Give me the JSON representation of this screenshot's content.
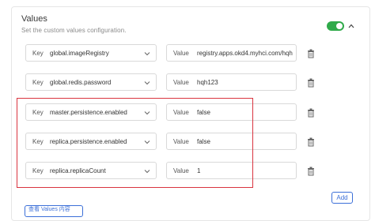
{
  "values_section": {
    "title": "Values",
    "subtitle": "Set the custom values configuration.",
    "toggle_on": true,
    "accent_color": "#2faa4a"
  },
  "rows": [
    {
      "key_label": "Key",
      "key": "global.imageRegistry",
      "value_label": "Value",
      "value": "registry.apps.okd4.myhci.com/hqh"
    },
    {
      "key_label": "Key",
      "key": "global.redis.password",
      "value_label": "Value",
      "value": "hqh123"
    },
    {
      "key_label": "Key",
      "key": "master.persistence.enabled",
      "value_label": "Value",
      "value": "false"
    },
    {
      "key_label": "Key",
      "key": "replica.persistence.enabled",
      "value_label": "Value",
      "value": "false"
    },
    {
      "key_label": "Key",
      "key": "replica.replicaCount",
      "value_label": "Value",
      "value": "1"
    }
  ],
  "actions": {
    "add_label": "Add",
    "partial_button_text": "查看 Values 内容"
  },
  "icons": {
    "toggle": "toggle-switch-icon",
    "collapse": "chevron-up-icon",
    "dropdown": "chevron-down-icon",
    "delete": "trash-icon"
  },
  "colors": {
    "highlight": "#d9343f",
    "link": "#3b6fd8"
  }
}
